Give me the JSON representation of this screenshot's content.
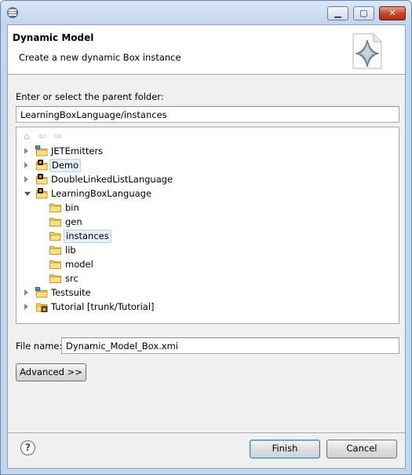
{
  "window": {
    "title": ""
  },
  "banner": {
    "title": "Dynamic Model",
    "description": "Create a new dynamic Box instance"
  },
  "parent_folder": {
    "label": "Enter or select the parent folder:",
    "value": "LearningBoxLanguage/instances"
  },
  "tree": {
    "items": [
      {
        "label": "JETEmitters",
        "depth": 0,
        "icon": "folder-project-icon",
        "expanded": false,
        "selected": false
      },
      {
        "label": "Demo",
        "depth": 0,
        "icon": "java-project-icon",
        "expanded": false,
        "selected": true
      },
      {
        "label": "DoubleLinkedListLanguage",
        "depth": 0,
        "icon": "java-project-icon",
        "expanded": false,
        "selected": false
      },
      {
        "label": "LearningBoxLanguage",
        "depth": 0,
        "icon": "java-project-icon",
        "expanded": true,
        "selected": false
      },
      {
        "label": "bin",
        "depth": 1,
        "icon": "folder-icon",
        "selected": false
      },
      {
        "label": "gen",
        "depth": 1,
        "icon": "folder-icon",
        "selected": false
      },
      {
        "label": "instances",
        "depth": 1,
        "icon": "folder-open-icon",
        "selected": true
      },
      {
        "label": "lib",
        "depth": 1,
        "icon": "folder-icon",
        "selected": false
      },
      {
        "label": "model",
        "depth": 1,
        "icon": "folder-icon",
        "selected": false
      },
      {
        "label": "src",
        "depth": 1,
        "icon": "folder-icon",
        "selected": false
      },
      {
        "label": "Testsuite",
        "depth": 0,
        "icon": "folder-project-icon",
        "expanded": false,
        "selected": false
      },
      {
        "label": "Tutorial [trunk/Tutorial]",
        "depth": 0,
        "icon": "svn-project-icon",
        "expanded": false,
        "selected": false
      }
    ]
  },
  "file_name": {
    "label": "File name:",
    "value": "Dynamic_Model_Box.xmi"
  },
  "buttons": {
    "advanced": "Advanced >>",
    "finish": "Finish",
    "cancel": "Cancel"
  },
  "titlebar_buttons": {
    "minimize": "▁",
    "maximize": "▢",
    "close": "✕"
  },
  "toolbar_icons": {
    "home": "⌂",
    "back": "⇦",
    "forward": "⇨"
  },
  "help": {
    "glyph": "?"
  }
}
